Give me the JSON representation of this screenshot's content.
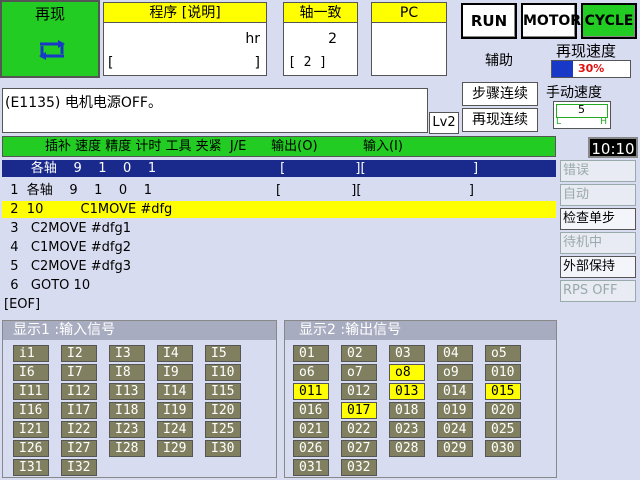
{
  "mode": {
    "label": "再现",
    "icon": "cycle-arrows-icon"
  },
  "program": {
    "title": "程序 [说明]",
    "unit": "hr",
    "bracket_left": "[",
    "bracket_right": "]"
  },
  "axis": {
    "title": "轴一致",
    "value": "2",
    "bracket_value": "[ 2 ]"
  },
  "pc": {
    "title": "PC"
  },
  "buttons": {
    "run": "RUN",
    "motor": "MOTOR",
    "cycle": "CYCLE"
  },
  "aux_label": "辅助",
  "replay_speed": {
    "label": "再现速度",
    "value": "30%"
  },
  "manual_speed": {
    "label": "手动速度",
    "value": "5",
    "low": "L",
    "high": "H"
  },
  "message": "(E1135) 电机电源OFF。",
  "level": "Lv2",
  "step_continuous": "步骤连续",
  "replay_continuous": "再现连续",
  "time": "10:10",
  "columns_header": "插补 速度 精度 计时 工具 夹紧  J/E      输出(O)           输入(I)",
  "program_rows": [
    "       各轴    9    1    0    1                              [                 ][                          ]",
    "  1  各轴    9    1    0    1                              [                 ][                          ]",
    "  2  10         C1MOVE #dfg",
    "  3   C2MOVE #dfg1",
    "  4   C1MOVE #dfg2",
    "  5   C2MOVE #dfg3",
    "  6   GOTO 10",
    "[EOF]"
  ],
  "side_buttons": [
    {
      "label": "错误",
      "active": false
    },
    {
      "label": "自动",
      "active": false
    },
    {
      "label": "检查单步",
      "active": true
    },
    {
      "label": "待机中",
      "active": false
    },
    {
      "label": "外部保持",
      "active": true
    },
    {
      "label": "RPS OFF",
      "active": false
    }
  ],
  "input_panel": {
    "title": "显示1 :输入信号",
    "signals": [
      "i1",
      "I2",
      "I3",
      "I4",
      "I5",
      "I6",
      "I7",
      "I8",
      "I9",
      "I10",
      "I11",
      "I12",
      "I13",
      "I14",
      "I15",
      "I16",
      "I17",
      "I18",
      "I19",
      "I20",
      "I21",
      "I22",
      "I23",
      "I24",
      "I25",
      "I26",
      "I27",
      "I28",
      "I29",
      "I30",
      "I31",
      "I32"
    ]
  },
  "output_panel": {
    "title": "显示2 :输出信号",
    "signals": [
      "01",
      "02",
      "03",
      "04",
      "o5",
      "o6",
      "o7",
      "o8",
      "o9",
      "010",
      "011",
      "012",
      "013",
      "014",
      "015",
      "016",
      "017",
      "018",
      "019",
      "020",
      "021",
      "022",
      "023",
      "024",
      "025",
      "026",
      "027",
      "028",
      "029",
      "030",
      "031",
      "032"
    ],
    "on": [
      "o8",
      "011",
      "013",
      "015",
      "017"
    ]
  },
  "colors": {
    "green": "#22cc22",
    "yellow": "#ffff00",
    "navy": "#1a2a8c",
    "signal_off": "#808060"
  }
}
